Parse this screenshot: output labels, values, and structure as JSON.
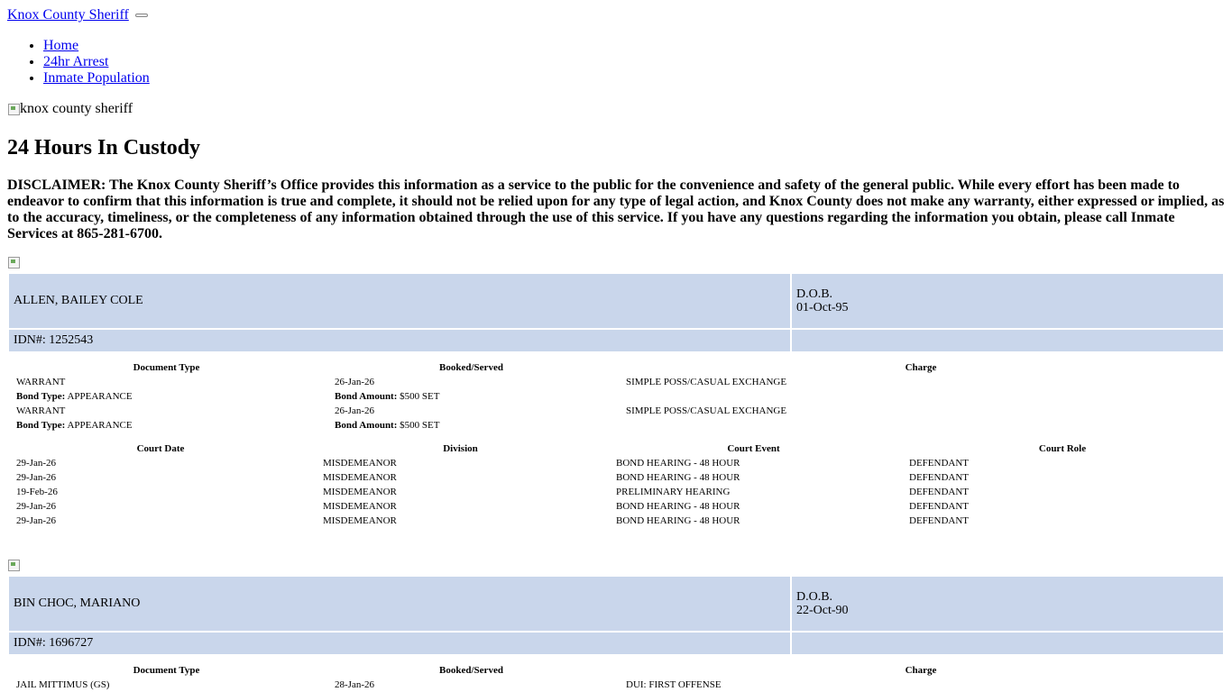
{
  "header": {
    "brand": "Knox County Sheriff",
    "nav": [
      "Home",
      "24hr Arrest",
      "Inmate Population"
    ]
  },
  "logo_alt": "knox county sheriff",
  "page_title": "24 Hours In Custody",
  "disclaimer": "DISCLAIMER: The Knox County Sheriff’s Office provides this information as a service to the public for the convenience and safety of the general public. While every effort has been made to endeavor to confirm that this information is true and complete, it should not be relied upon for any type of legal action, and Knox County does not make any warranty, either expressed or implied, as to the accuracy, timeliness, or the completeness of any information obtained through the use of this service. If you have any questions regarding the information you obtain, please call Inmate Services at 865-281-6700.",
  "labels": {
    "dob": "D.O.B.",
    "idn_prefix": "IDN#: ",
    "bond_type": "Bond Type:",
    "bond_amount": "Bond Amount:",
    "charge_headers": [
      "Document Type",
      "Booked/Served",
      "Charge"
    ],
    "court_headers": [
      "Court Date",
      "Division",
      "Court Event",
      "Court Role"
    ]
  },
  "inmates": [
    {
      "name": "ALLEN, BAILEY COLE",
      "dob": "01-Oct-95",
      "idn": "1252543",
      "charges": [
        {
          "doc_type": "WARRANT",
          "booked": "26-Jan-26",
          "charge": "SIMPLE POSS/CASUAL EXCHANGE",
          "bond_type": "APPEARANCE",
          "bond_amount": "$500 SET"
        },
        {
          "doc_type": "WARRANT",
          "booked": "26-Jan-26",
          "charge": "SIMPLE POSS/CASUAL EXCHANGE",
          "bond_type": "APPEARANCE",
          "bond_amount": "$500 SET"
        }
      ],
      "court": [
        {
          "date": "29-Jan-26",
          "division": "MISDEMEANOR",
          "event": "BOND HEARING - 48 HOUR",
          "role": "DEFENDANT"
        },
        {
          "date": "29-Jan-26",
          "division": "MISDEMEANOR",
          "event": "BOND HEARING - 48 HOUR",
          "role": "DEFENDANT"
        },
        {
          "date": "19-Feb-26",
          "division": "MISDEMEANOR",
          "event": "PRELIMINARY HEARING",
          "role": "DEFENDANT"
        },
        {
          "date": "29-Jan-26",
          "division": "MISDEMEANOR",
          "event": "BOND HEARING - 48 HOUR",
          "role": "DEFENDANT"
        },
        {
          "date": "29-Jan-26",
          "division": "MISDEMEANOR",
          "event": "BOND HEARING - 48 HOUR",
          "role": "DEFENDANT"
        }
      ]
    },
    {
      "name": "BIN CHOC, MARIANO",
      "dob": "22-Oct-90",
      "idn": "1696727",
      "charges": [
        {
          "doc_type": "JAIL MITTIMUS (GS)",
          "booked": "28-Jan-26",
          "charge": "DUI: FIRST OFFENSE"
        }
      ],
      "court": []
    }
  ]
}
